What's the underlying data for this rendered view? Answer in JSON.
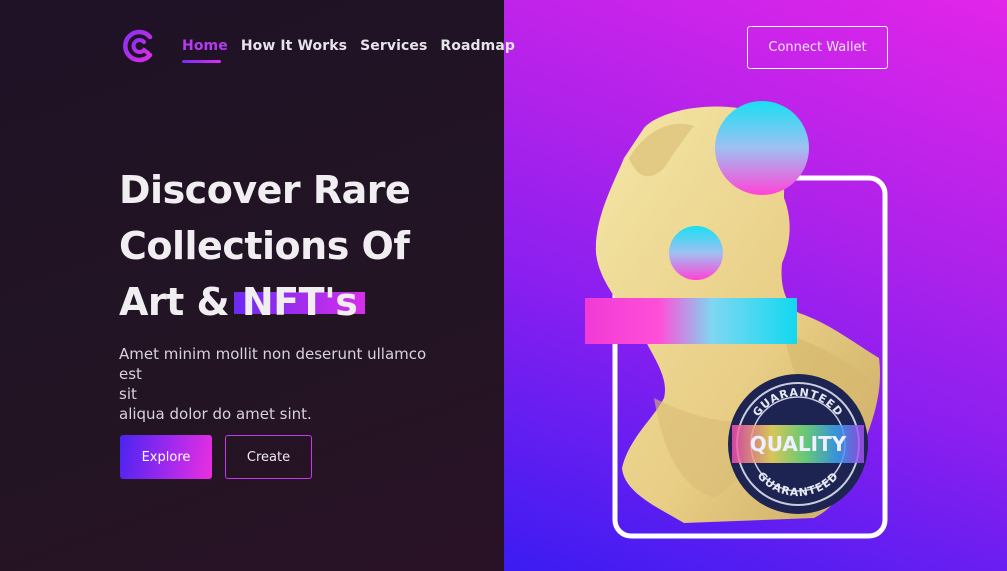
{
  "nav": {
    "items": [
      {
        "label": "Home",
        "active": true
      },
      {
        "label": "How It Works",
        "active": false
      },
      {
        "label": "Services",
        "active": false
      },
      {
        "label": "Roadmap",
        "active": false
      }
    ],
    "connect_label": "Connect Wallet"
  },
  "hero": {
    "line1": "Discover Rare",
    "line2": "Collections Of",
    "line3_prefix": "Art & ",
    "highlight": "NFT's",
    "sub_line1": "Amet minim mollit non deserunt ullamco est",
    "sub_line2": "sit",
    "sub_line3": "aliqua dolor do amet sint.",
    "explore_label": "Explore",
    "create_label": "Create"
  },
  "badge": {
    "top_text": "GUARANTEED",
    "main_text": "QUALITY",
    "bottom_text": "GUARANTEED"
  },
  "colors": {
    "accent": "#b63bf0",
    "gradient_start": "#4a24f0",
    "gradient_end": "#ea2fe0"
  }
}
